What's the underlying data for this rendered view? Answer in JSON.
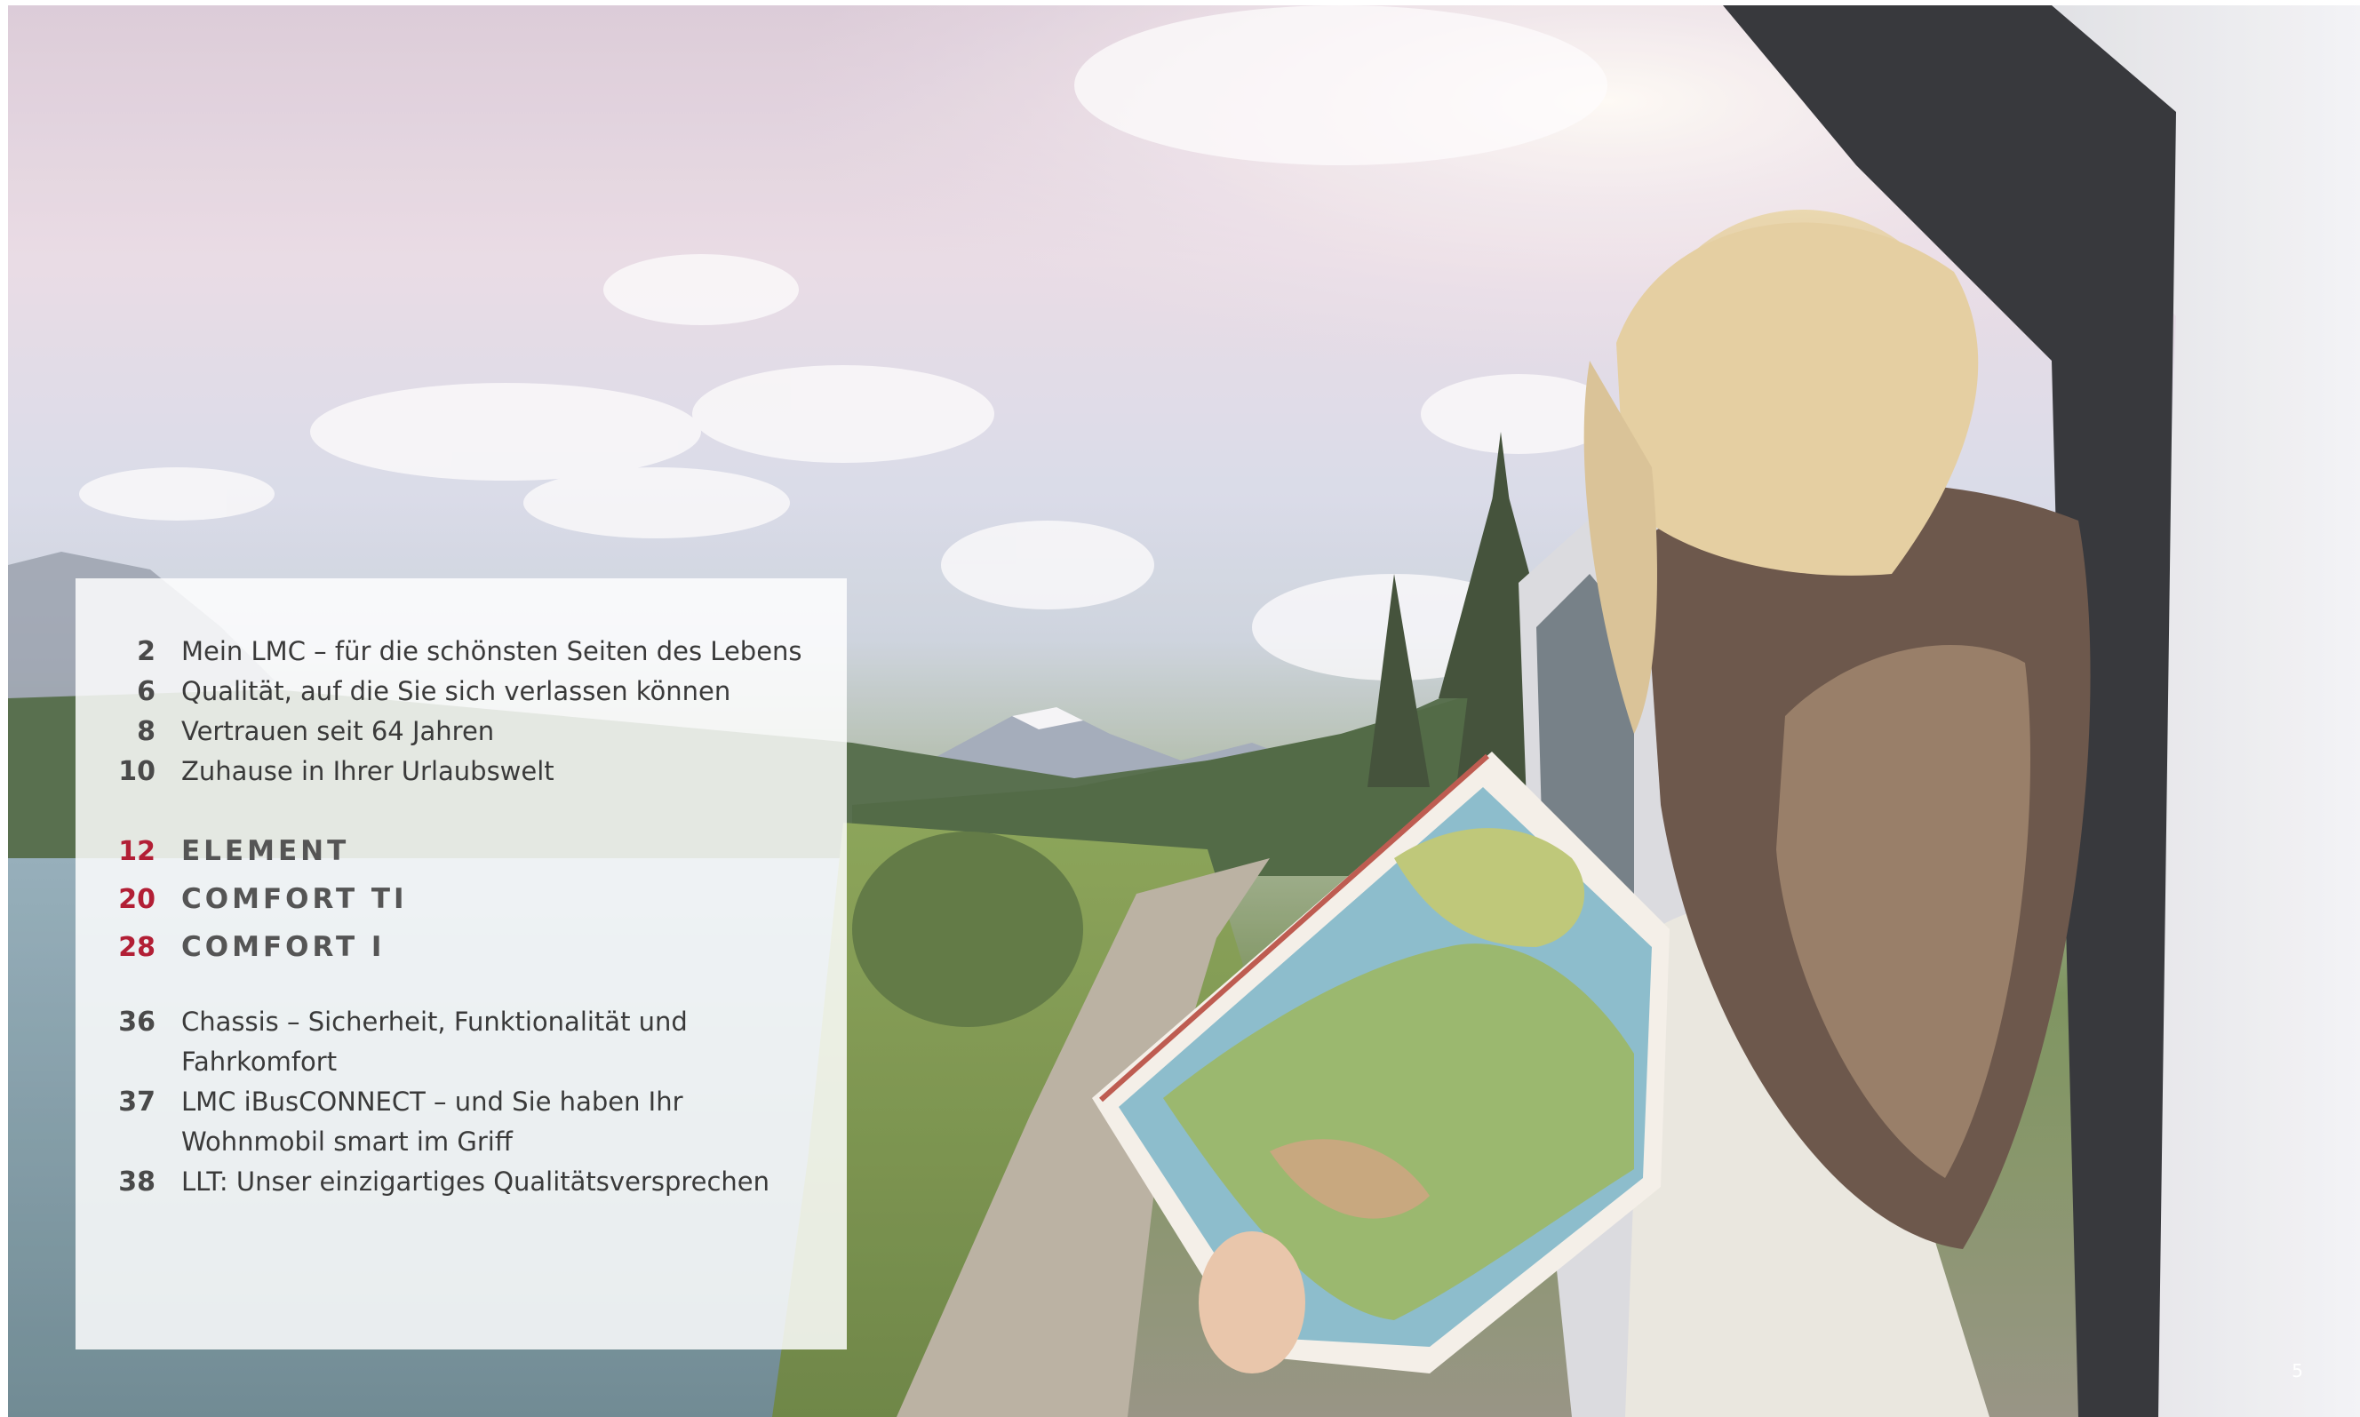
{
  "toc": {
    "general": [
      {
        "num": "2",
        "label": "Mein LMC – für die schönsten Seiten des Lebens"
      },
      {
        "num": "6",
        "label": "Qualität, auf die Sie sich verlassen können"
      },
      {
        "num": "8",
        "label": "Vertrauen seit 64 Jahren"
      },
      {
        "num": "10",
        "label": "Zuhause in Ihrer Urlaubswelt"
      }
    ],
    "models": [
      {
        "num": "12",
        "label": "ELEMENT"
      },
      {
        "num": "20",
        "label": "COMFORT TI"
      },
      {
        "num": "28",
        "label": "COMFORT I"
      }
    ],
    "features": [
      {
        "num": "36",
        "line1": "Chassis – Sicherheit, Funktionalität und",
        "line2": "Fahrkomfort"
      },
      {
        "num": "37",
        "line1": "LMC iBusCONNECT – und Sie haben Ihr",
        "line2": "Wohnmobil smart im Griff"
      },
      {
        "num": "38",
        "line1": "LLT: Unser einzigartiges Qualitätsversprechen"
      }
    ]
  },
  "page_number": "5",
  "colors": {
    "accent": "#b21f35",
    "text": "#3a3a3a",
    "panel": "#ffffff"
  }
}
